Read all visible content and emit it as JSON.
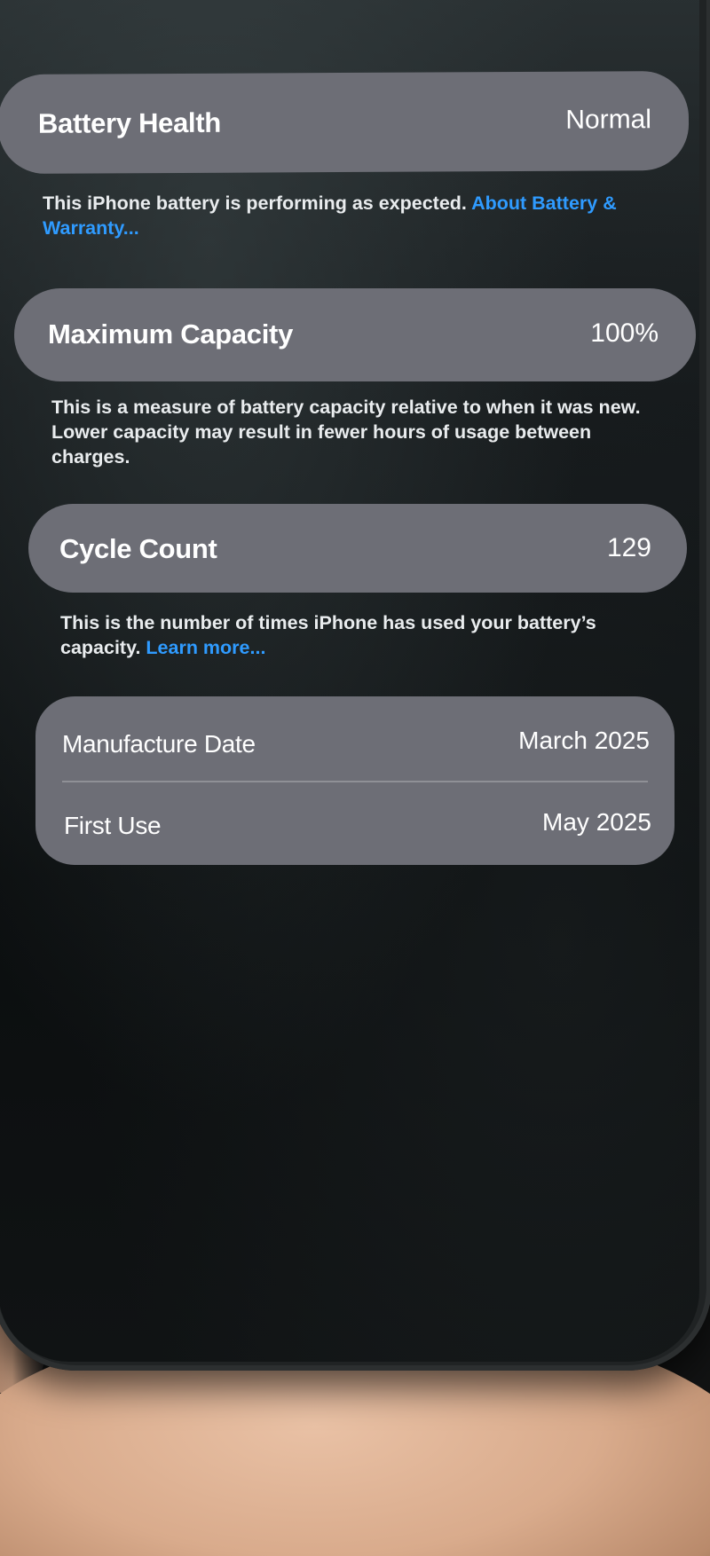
{
  "battery_health": {
    "label": "Battery Health",
    "value": "Normal",
    "footer_text": "This iPhone battery is performing as expected. ",
    "footer_link": "About Battery & Warranty..."
  },
  "maximum_capacity": {
    "label": "Maximum Capacity",
    "value": "100%",
    "footer_text": "This is a measure of battery capacity relative to when it was new. Lower capacity may result in fewer hours of usage between charges."
  },
  "cycle_count": {
    "label": "Cycle Count",
    "value": "129",
    "footer_text": "This is the number of times iPhone has used your battery’s capacity. ",
    "footer_link": "Learn more..."
  },
  "dates": {
    "manufacture_label": "Manufacture Date",
    "manufacture_value": "March 2025",
    "first_use_label": "First Use",
    "first_use_value": "May 2025"
  },
  "colors": {
    "card_background": "#6d6e76",
    "link": "#2f9bff",
    "screen_background": "#0b0e0f"
  }
}
